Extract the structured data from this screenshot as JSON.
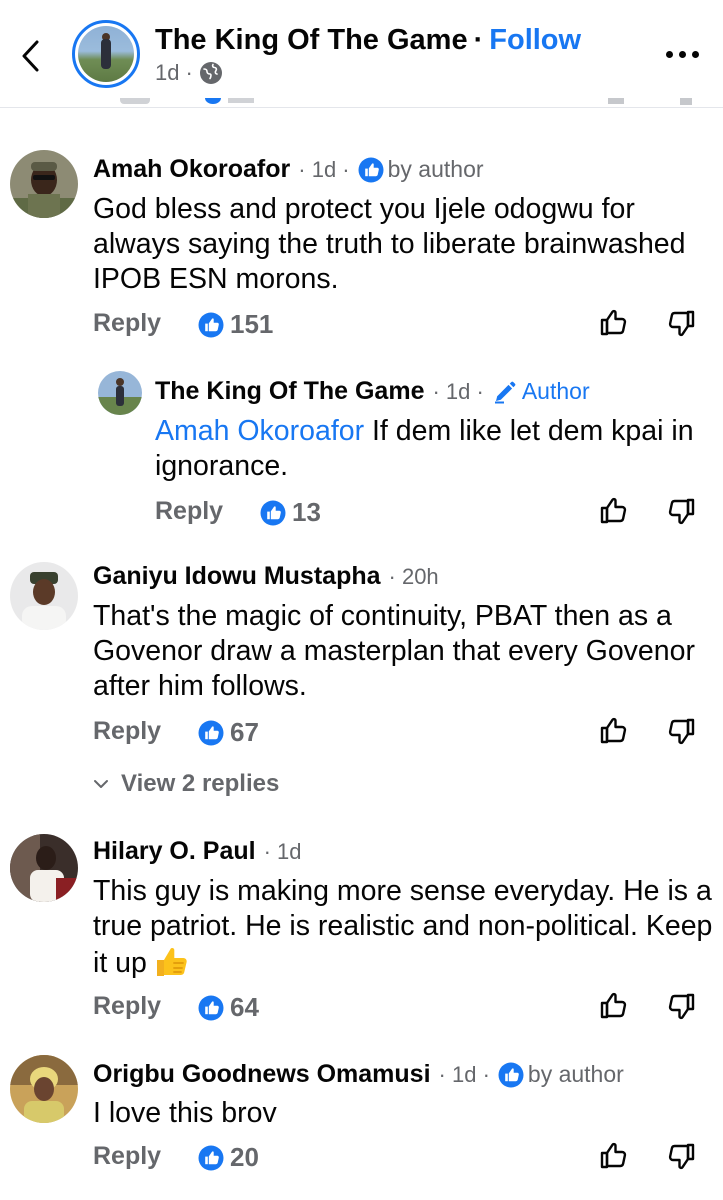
{
  "header": {
    "title": "The King Of The Game",
    "separator": "·",
    "follow_label": "Follow",
    "time": "1d",
    "time_sep": "·"
  },
  "comments": [
    {
      "name": "Amah Okoroafor",
      "time": "· 1d ·",
      "badge": "by author",
      "text": "God bless and protect you Ijele odogwu for always saying the truth to liberate brainwashed IPOB ESN morons.",
      "reply_label": "Reply",
      "likes": "151"
    },
    {
      "name": "The King Of The Game",
      "time": "· 1d ·",
      "badge": "Author",
      "mention": "Amah Okoroafor",
      "text": " If dem like let dem kpai in ignorance.",
      "reply_label": "Reply",
      "likes": "13"
    },
    {
      "name": "Ganiyu Idowu Mustapha",
      "time": "· 20h",
      "text": "That's the magic of continuity, PBAT then as a Govenor draw a masterplan that every Govenor after him follows.",
      "reply_label": "Reply",
      "likes": "67",
      "view_replies": "View 2 replies"
    },
    {
      "name": "Hilary O. Paul",
      "time": "· 1d",
      "text": "This guy is making more sense everyday. He is a true patriot. He is realistic and non-political. Keep it up",
      "emoji": "thumbs-up-emoji",
      "reply_label": "Reply",
      "likes": "64"
    },
    {
      "name": "Origbu Goodnews Omamusi",
      "time": "· 1d ·",
      "badge": "by author",
      "text": "I love this brov",
      "reply_label": "Reply",
      "likes": "20"
    }
  ],
  "icons": {
    "back": "back-chevron-icon",
    "globe": "globe-icon",
    "more": "more-dots-icon",
    "like_badge": "like-badge-icon",
    "author_pencil": "pencil-icon",
    "thumb_up": "thumbs-up-outline-icon",
    "thumb_down": "thumbs-down-outline-icon",
    "chevron": "chevron-down-icon"
  },
  "colors": {
    "accent": "#1877f2",
    "secondary_text": "#65676b",
    "primary_text": "#050505"
  }
}
